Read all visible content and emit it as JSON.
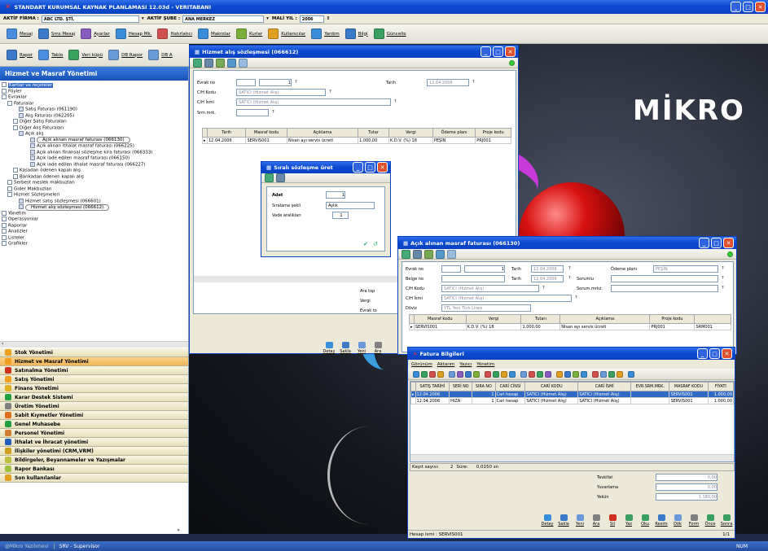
{
  "app": {
    "title": "STANDART KURUMSAL KAYNAK PLANLAMASI 12.03d - VERITABANI",
    "aktif_firma_label": "AKTİF FİRMA :",
    "aktif_firma_value": "ABC LTD. ŞTİ.",
    "aktif_sube_label": "AKTİF ŞUBE :",
    "aktif_sube_value": "ANA MERKEZ",
    "mali_yil_label": "MALİ YIL :",
    "mali_yil_value": "2006",
    "toolbar1": [
      "Mesaj",
      "Sms Mesaj",
      "Ayarlar",
      "Hesap Mk.",
      "Hatırlatıcı",
      "Makrolar",
      "Kurlar",
      "Kullanıcılar",
      "Yardım",
      "Bilgi",
      "Güncelle"
    ],
    "toolbar2": [
      "Rapor",
      "Tablo",
      "Veri küpü",
      "DB Rapor",
      "DB A"
    ]
  },
  "sidebar": {
    "title": "Hizmet ve Masraf Yönetimi",
    "tree": [
      {
        "t": "Kartlar ve reçeteler",
        "l": 0,
        "sel": true
      },
      {
        "t": "Föyler",
        "l": 0
      },
      {
        "t": "Evraklar",
        "l": 0
      },
      {
        "t": "Faturalar",
        "l": 1
      },
      {
        "t": "Satış Faturası (061190)",
        "l": 3
      },
      {
        "t": "Alış Faturası (062205)",
        "l": 3
      },
      {
        "t": "Diğer Satış Faturaları",
        "l": 2
      },
      {
        "t": "Diğer Alış Faturaları",
        "l": 2
      },
      {
        "t": "Açık alış",
        "l": 3
      },
      {
        "t": "Açık alınan masraf faturası (066130)",
        "l": 5,
        "circle": true
      },
      {
        "t": "Açık alınan ithalat masraf faturası (066225)",
        "l": 5
      },
      {
        "t": "Açık alınan finansal sözleşme kira faturası (066333)",
        "l": 5
      },
      {
        "t": "Açık iade edilen masraf faturası (066150)",
        "l": 5
      },
      {
        "t": "Açık iade edilen ithalat masraf faturası (066227)",
        "l": 5
      },
      {
        "t": "Kasadan ödenen kapalı alış",
        "l": 2
      },
      {
        "t": "Bankadan ödenen kapalı alış",
        "l": 2
      },
      {
        "t": "Serbest meslek makbuzları",
        "l": 1
      },
      {
        "t": "Gider Makbuzları",
        "l": 1
      },
      {
        "t": "Hizmet Sözleşmeleri",
        "l": 1
      },
      {
        "t": "Hizmet satış sözleşmesi (066601)",
        "l": 3
      },
      {
        "t": "Hizmet alış sözleşmesi (066612)",
        "l": 3,
        "circle": true
      },
      {
        "t": "Yönetim",
        "l": 0
      },
      {
        "t": "Operasyonlar",
        "l": 0
      },
      {
        "t": "Raporlar",
        "l": 0
      },
      {
        "t": "Analizler",
        "l": 0
      },
      {
        "t": "Listeler",
        "l": 0
      },
      {
        "t": "Grafikler",
        "l": 0
      }
    ],
    "modules": [
      {
        "t": "Stok Yönetimi",
        "c": "#f0a020"
      },
      {
        "t": "Hizmet ve Masraf Yönetimi",
        "c": "#f0a020",
        "active": true
      },
      {
        "t": "Satınalma Yönetimi",
        "c": "#d03020"
      },
      {
        "t": "Satış Yönetimi",
        "c": "#f0a020"
      },
      {
        "t": "Finans Yönetimi",
        "c": "#e0b020"
      },
      {
        "t": "Karar Destek Sistemi",
        "c": "#20a040"
      },
      {
        "t": "Üretim Yönetimi",
        "c": "#808080"
      },
      {
        "t": "Sabit Kıymetler Yönetimi",
        "c": "#e07020"
      },
      {
        "t": "Genel Muhasebe",
        "c": "#20a040"
      },
      {
        "t": "Personel Yönetimi",
        "c": "#d08030"
      },
      {
        "t": "İthalat ve İhracat yönetimi",
        "c": "#2060c0"
      },
      {
        "t": "İlişkiler yönetimi (CRM,VRM)",
        "c": "#d0a020"
      },
      {
        "t": "Bildirgeler, Beyannameler ve Yazışmalar",
        "c": "#c0c040"
      },
      {
        "t": "Rapor Bankası",
        "c": "#a0c040"
      },
      {
        "t": "Son kullanılanlar",
        "c": "#e0a020"
      }
    ]
  },
  "status": {
    "left": "@Mikro Yazılımevi",
    "user": "SRV - Supervisor",
    "num": "NUM"
  },
  "brand": "MİKRO",
  "win1": {
    "title": "Hizmet alış sözleşmesi (066612)",
    "evrak_no": "Evrak no",
    "evrak_num": "1",
    "tarih": "Tarih",
    "tarih_val": "12.04.2006",
    "ch_kodu": "C/H Kodu",
    "ch_kodu_val": "SATICI (Hizmet Alış)",
    "ch_ismi": "C/H İsmi",
    "ch_ismi_val": "SATICI (Hizmet Alış)",
    "srm": "Srm.mrk.",
    "cols": [
      "Tarih",
      "Masraf kodu",
      "Açıklama",
      "Tutar",
      "Vergi",
      "Ödeme planı",
      "Proje kodu"
    ],
    "row": [
      "12.04.2006",
      "SERVIS001",
      "Nisan ayı servis ücreti",
      "1.000,00",
      "K.D.V. (%) 18",
      "PEŞİN",
      "PRJ001"
    ],
    "totals": [
      "Ara top",
      "Vergi",
      "Evrak to"
    ],
    "buttons": [
      "Detay",
      "Sakla",
      "Yeni",
      "Ara"
    ]
  },
  "win2": {
    "title": "Sıralı sözleşme üret",
    "adet": "Adet",
    "adet_val": "1",
    "siralama": "Sıralama şekli",
    "siralama_val": "Aylık",
    "vade": "Vade aralıkları",
    "vade_val": "1"
  },
  "win3": {
    "title": "Açık alınan masraf faturası (066130)",
    "evrak_no": "Evrak no",
    "evrak_num": "1",
    "tarih": "Tarih",
    "tarih_val": "12.04.2006",
    "odeme": "Ödeme planı",
    "odeme_val": "PEŞİN",
    "belge": "Belge no",
    "tarih2": "Tarih",
    "tarih2_val": "12.04.2006",
    "sorumlu": "Sorumlu",
    "ch_kodu": "C/H Kodu",
    "ch_kodu_val": "SATICI (Hizmet Alış)",
    "sorum_mrkz": "Sorum.mrkz.",
    "ch_ismi": "C/H İsmi",
    "ch_ismi_val": "SATICI (Hizmet Alış)",
    "doviz": "Döviz",
    "doviz_val": "YTL Yeni Türk Lirası",
    "cols": [
      "Masraf kodu",
      "Vergi",
      "Tutarı",
      "Açıklama",
      "Proje kodu"
    ],
    "row": [
      "SERVIS001",
      "K.D.V. (%) 18",
      "1.000,00",
      "Nisan ayı servis ücreti",
      "PRJ001",
      "SRM001"
    ]
  },
  "win4": {
    "title": "Fatura Bilgileri",
    "menu": [
      "Görünüm",
      "Aktarım",
      "Yazıcı",
      "Yönetim"
    ],
    "cols": [
      "SATIŞ TARİHİ",
      "SERİ NO",
      "SIRA NO",
      "CARİ CİNSİ",
      "CARİ KODU",
      "CARİ İSMİ",
      "EVR.SRM.MRK.",
      "MASRAF KODU",
      "FİYATI"
    ],
    "rows": [
      [
        "12.04.2006",
        "",
        "1",
        "Cari hesap",
        "SATICI (Hizmet Alış)",
        "SATICI (Hizmet Alış)",
        "",
        "SERVIS001",
        "1.000,00"
      ],
      [
        "12.04.2006",
        "HIZA",
        "1",
        "Cari hesap",
        "SATICI (Hizmet Alış)",
        "SATICI (Hizmet Alış)",
        "",
        "SERVIS001",
        "1.000,00"
      ]
    ],
    "kayit": "Kayıt sayısı:",
    "kayit_val": "2",
    "sure": "Süre:",
    "sure_val": "0,0150 sn",
    "tevkifat": "Tevkifat",
    "tevkifat_val": "0,00",
    "yuvarlama": "Yuvarlama",
    "yuvarlama_val": "0,00",
    "yekun": "Yekün",
    "yekun_val": "1.180,00",
    "buttons": [
      "Detay",
      "Sakla",
      "Yeni",
      "Ara",
      "Sil",
      "Yaz",
      "Oku",
      "Resim",
      "Dök",
      "Form",
      "Önce",
      "Sonra"
    ],
    "hesap": "Hesap ismi : SERVIS001",
    "page": "1/1"
  }
}
